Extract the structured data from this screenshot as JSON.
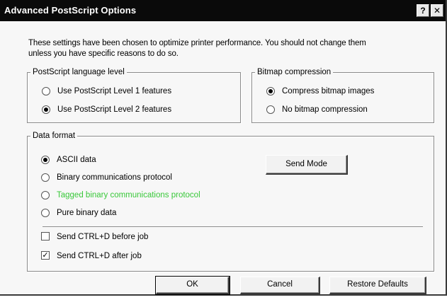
{
  "dialog": {
    "title": "Advanced PostScript Options",
    "help_glyph": "?",
    "close_glyph": "✕",
    "intro_line1": "These settings have been chosen to optimize printer performance. You should not change them",
    "intro_line2": "unless you have specific reasons to do so."
  },
  "postscript_level": {
    "legend": "PostScript language level",
    "options": [
      {
        "label": "Use PostScript Level 1 features",
        "selected": false
      },
      {
        "label": "Use PostScript Level 2 features",
        "selected": true
      }
    ]
  },
  "bitmap_compression": {
    "legend": "Bitmap compression",
    "options": [
      {
        "label": "Compress bitmap images",
        "selected": true
      },
      {
        "label": "No bitmap compression",
        "selected": false
      }
    ]
  },
  "data_format": {
    "legend": "Data format",
    "options": [
      {
        "label": "ASCII data",
        "selected": true
      },
      {
        "label": "Binary communications protocol",
        "selected": false
      },
      {
        "label": "Tagged binary communications protocol",
        "selected": false,
        "color": "#39c83a"
      },
      {
        "label": "Pure binary data",
        "selected": false
      }
    ],
    "send_mode_label": "Send Mode",
    "checkboxes": [
      {
        "label": "Send CTRL+D before job",
        "checked": false
      },
      {
        "label": "Send CTRL+D after job",
        "checked": true
      }
    ]
  },
  "buttons": {
    "ok": "OK",
    "cancel": "Cancel",
    "restore_defaults": "Restore Defaults"
  }
}
